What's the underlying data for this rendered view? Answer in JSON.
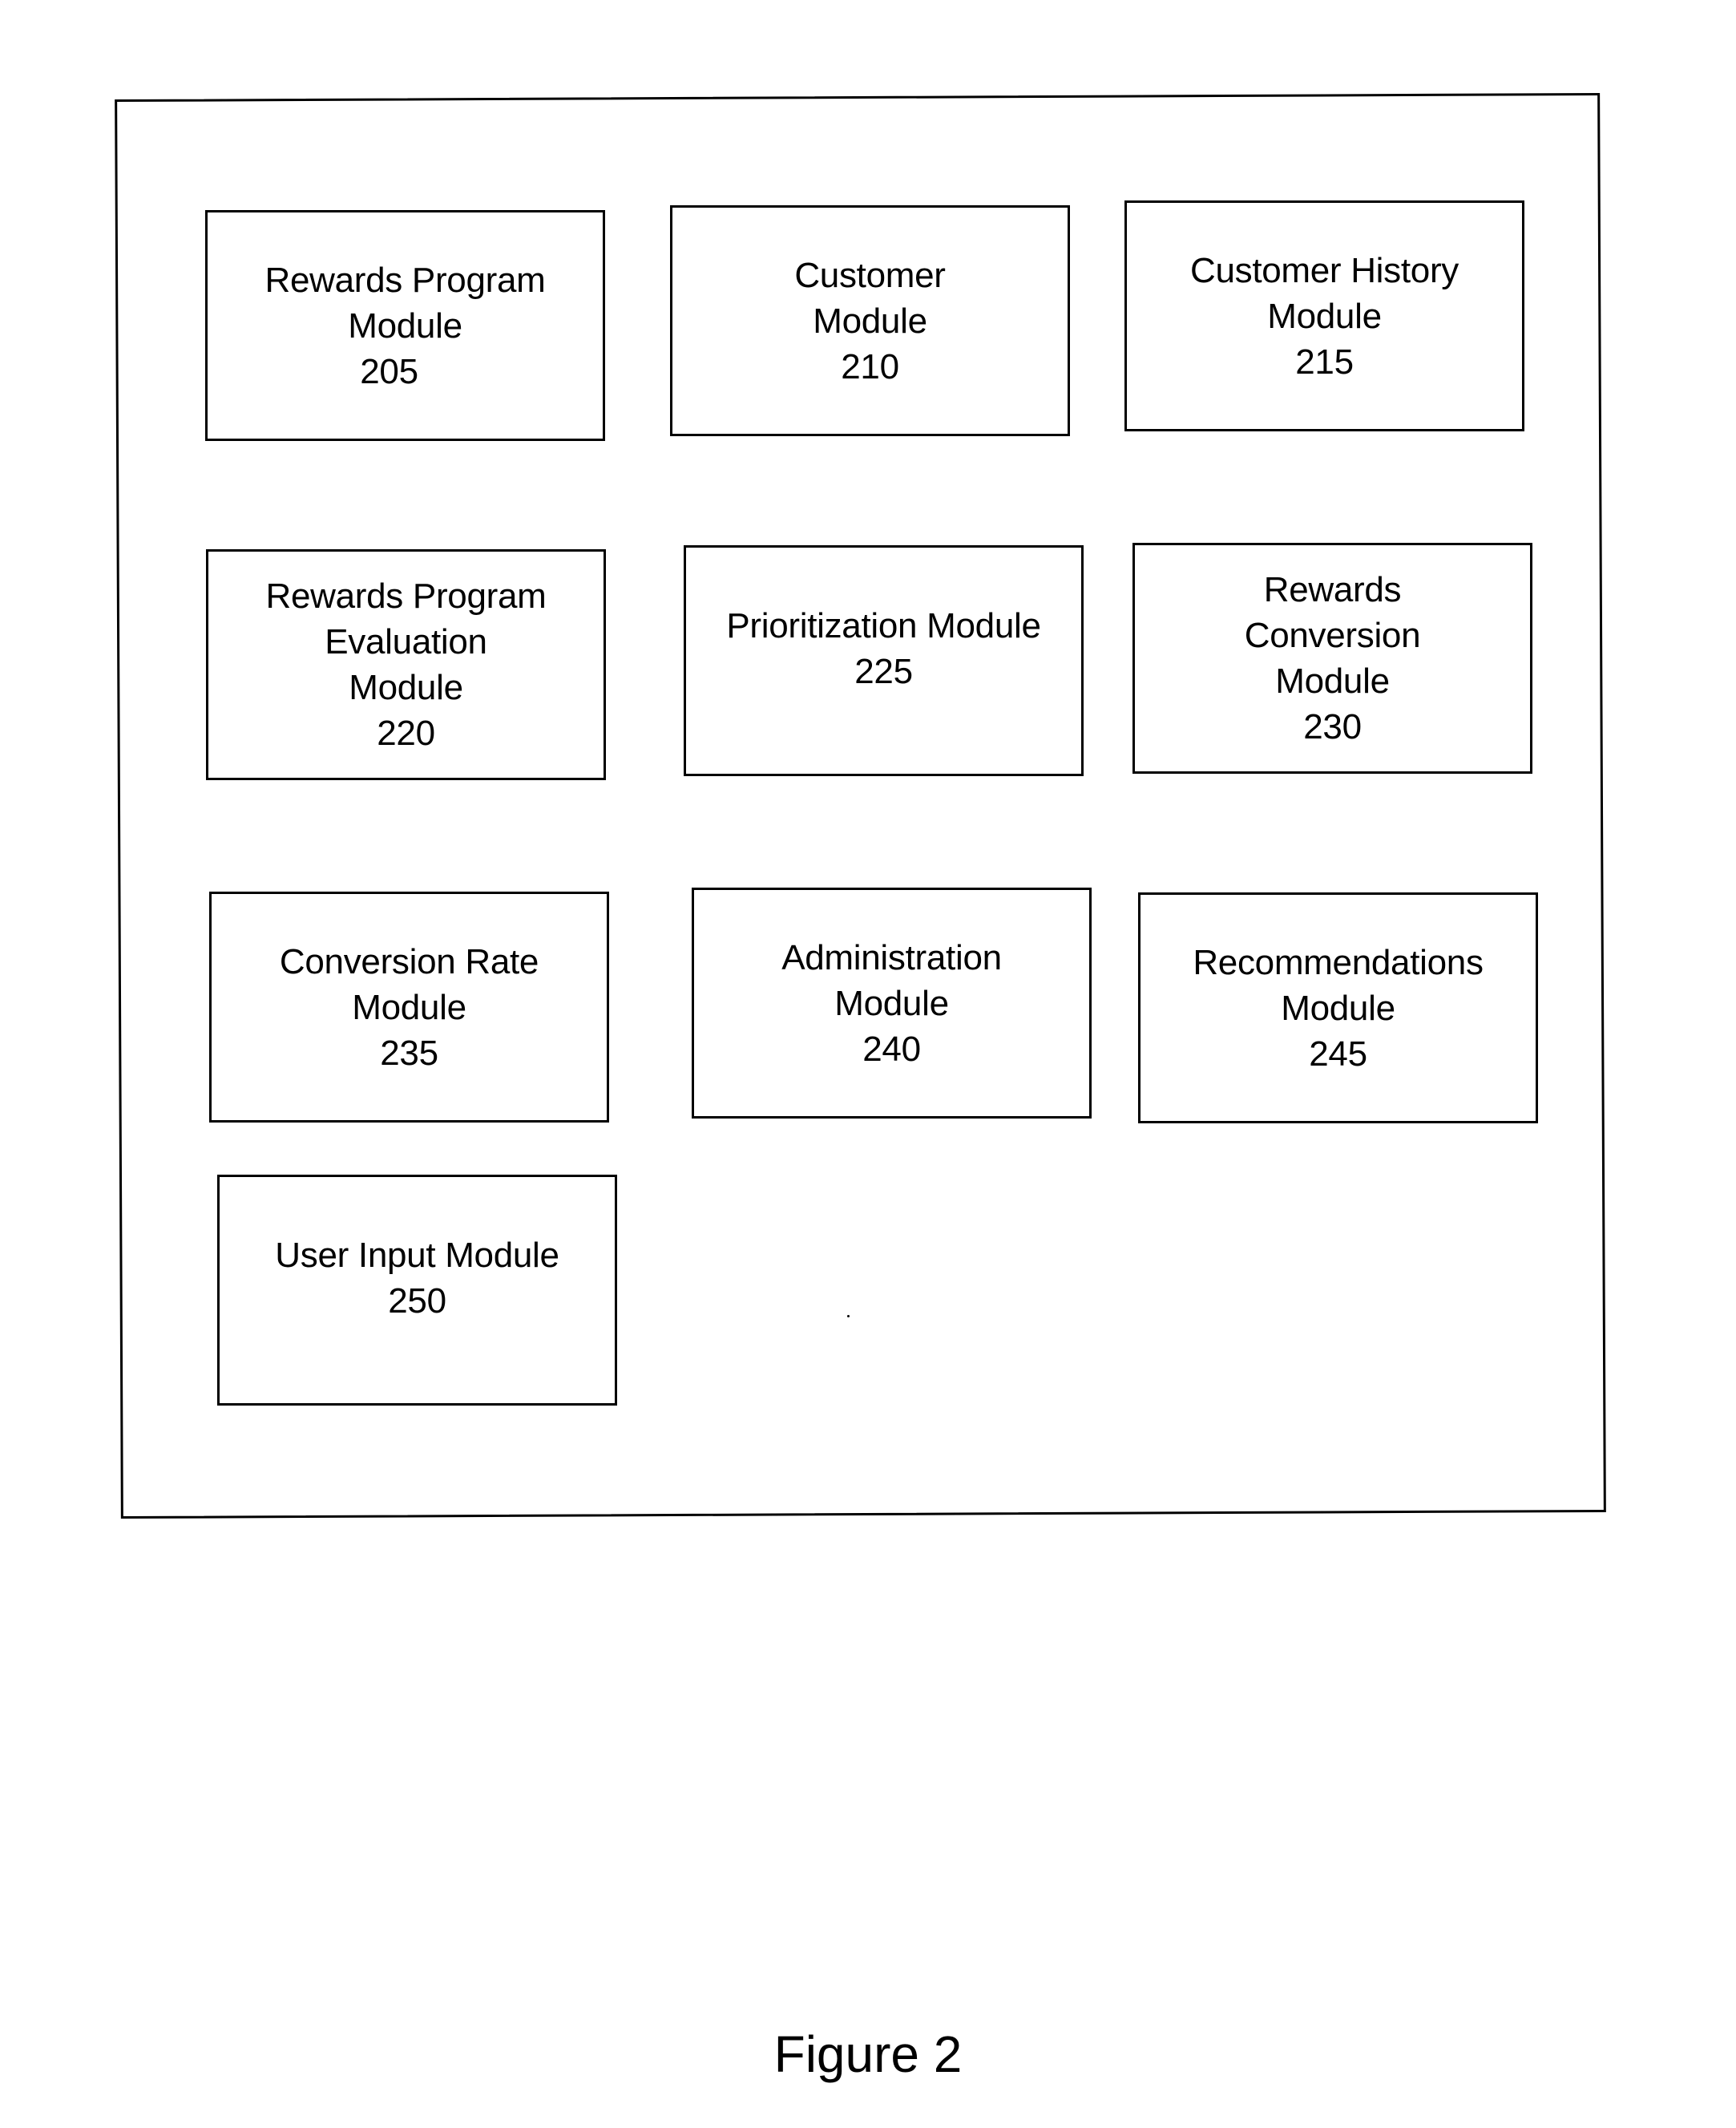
{
  "diagram": {
    "caption": "Figure 2",
    "modules": [
      {
        "id": "205",
        "lines": [
          "Rewards Program",
          "Module"
        ],
        "ref": "205"
      },
      {
        "id": "210",
        "lines": [
          "Customer",
          "Module"
        ],
        "ref": "210"
      },
      {
        "id": "215",
        "lines": [
          "Customer History",
          "Module"
        ],
        "ref": "215"
      },
      {
        "id": "220",
        "lines": [
          "Rewards Program",
          "Evaluation",
          "Module"
        ],
        "ref": "220"
      },
      {
        "id": "225",
        "lines": [
          "Prioritization Module"
        ],
        "ref": "225"
      },
      {
        "id": "230",
        "lines": [
          "Rewards",
          "Conversion",
          "Module"
        ],
        "ref": "230"
      },
      {
        "id": "235",
        "lines": [
          "Conversion Rate",
          "Module"
        ],
        "ref": "235"
      },
      {
        "id": "240",
        "lines": [
          "Administration",
          "Module"
        ],
        "ref": "240"
      },
      {
        "id": "245",
        "lines": [
          "Recommendations",
          "Module"
        ],
        "ref": "245"
      },
      {
        "id": "250",
        "lines": [
          "User Input Module"
        ],
        "ref": "250"
      }
    ]
  }
}
